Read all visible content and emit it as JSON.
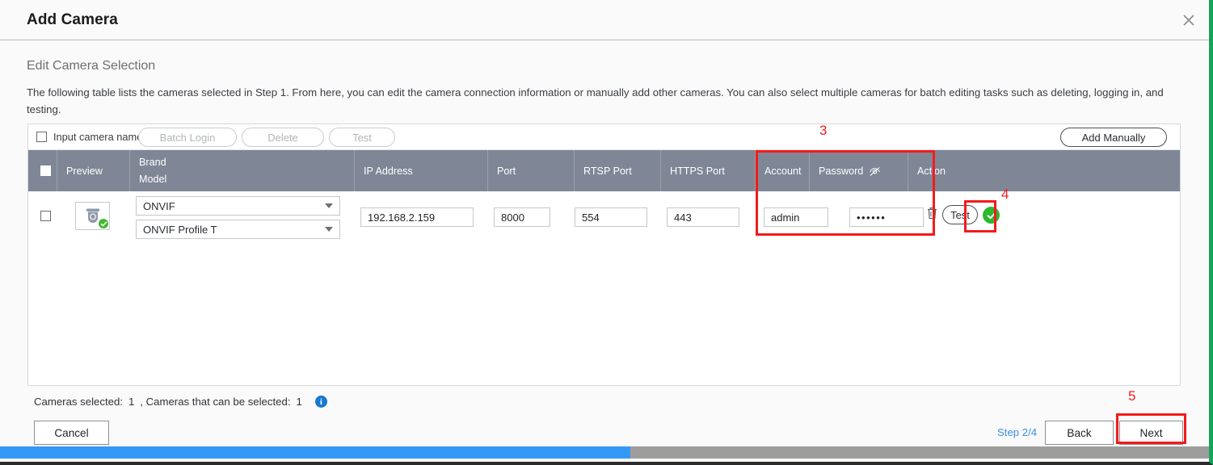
{
  "window": {
    "title": "Add Camera",
    "close_icon": "close-icon"
  },
  "section": {
    "title": "Edit Camera Selection",
    "description": "The following table lists the cameras selected in Step 1. From here, you can edit the camera connection information or manually add other cameras. You can also select multiple cameras for batch editing tasks such as deleting, logging in, and testing."
  },
  "toolbar": {
    "select_all_label": "Input camera name",
    "batch_login_label": "Batch Login",
    "delete_label": "Delete",
    "test_label": "Test",
    "add_manually_label": "Add Manually"
  },
  "table": {
    "headers": {
      "preview": "Preview",
      "brand": "Brand",
      "model": "Model",
      "ip_address": "IP Address",
      "port": "Port",
      "rtsp_port": "RTSP Port",
      "https_port": "HTTPS Port",
      "account": "Account",
      "password": "Password",
      "password_eye_icon": "eye-off-icon",
      "action": "Action"
    },
    "rows": [
      {
        "checked": false,
        "preview_icon": "dome-camera-icon",
        "preview_status_icon": "green-check-badge-icon",
        "brand": "ONVIF",
        "brand_options": [
          "ONVIF"
        ],
        "model": "ONVIF Profile T",
        "model_options": [
          "ONVIF Profile T"
        ],
        "ip_address": "192.168.2.159",
        "port": "8000",
        "rtsp_port": "554",
        "https_port": "443",
        "account": "admin",
        "password": "••••••",
        "delete_icon": "trash-icon",
        "test_label": "Test",
        "result_icon": "success-check-icon"
      }
    ]
  },
  "footer": {
    "selected_prefix": "Cameras selected:",
    "selected_count": "1",
    "available_prefix": ", Cameras that can be selected:",
    "available_count": "1",
    "info_icon": "info-icon",
    "info_glyph": "i",
    "cancel_label": "Cancel",
    "step_label": "Step 2/4",
    "back_label": "Back",
    "next_label": "Next"
  },
  "annotations": {
    "credentials": "3",
    "test": "4",
    "next": "5"
  },
  "colors": {
    "header_bg": "#7f8696",
    "accent_blue": "#3a8ee6",
    "annotation_red": "#f31b1b",
    "success_green": "#2fb62f",
    "scrollbar_thumb": "#3397f7",
    "window_edge_green": "#16a45c"
  }
}
